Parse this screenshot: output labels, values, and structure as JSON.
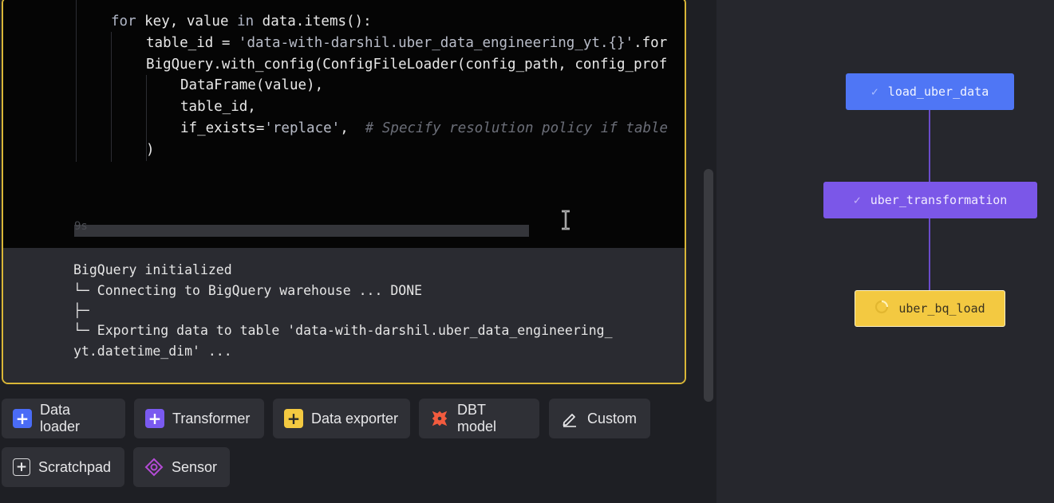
{
  "code": {
    "lines": {
      "l1": {
        "kw_for": "for",
        "rest1": " key, value ",
        "kw_in": "in",
        "rest2": " data.items():"
      },
      "l2": {
        "pre": "table_id = ",
        "str": "'data-with-darshil.uber_data_engineering_yt.{}'",
        "post": ".for"
      },
      "l3": {
        "text": "BigQuery.with_config(ConfigFileLoader(config_path, config_prof"
      },
      "l4": {
        "text": "DataFrame(value),"
      },
      "l5": {
        "text": "table_id,"
      },
      "l6": {
        "pre": "if_exists=",
        "str": "'replace'",
        "sep": ",  ",
        "comment": "# Specify resolution policy if table"
      },
      "l7": {
        "text": ")"
      }
    },
    "timer": "9s",
    "progress_fraction": 1.0
  },
  "output": {
    "lines": [
      "BigQuery initialized",
      "└─ Connecting to BigQuery warehouse ... DONE",
      "├─",
      "└─ Exporting data to table 'data-with-darshil.uber_data_engineering_",
      "yt.datetime_dim' ..."
    ]
  },
  "add_buttons": {
    "data_loader": {
      "label": "Data loader",
      "icon": "plus-icon",
      "color": "#4a6cf7"
    },
    "transformer": {
      "label": "Transformer",
      "icon": "plus-icon",
      "color": "#7a5af0"
    },
    "data_exporter": {
      "label": "Data exporter",
      "icon": "plus-icon",
      "color": "#f3c941"
    },
    "dbt_model": {
      "label": "DBT model",
      "icon": "dbt-logo-icon",
      "color": "#f25b3e"
    },
    "custom": {
      "label": "Custom",
      "icon": "pencil-icon"
    },
    "scratchpad": {
      "label": "Scratchpad",
      "icon": "plus-icon"
    },
    "sensor": {
      "label": "Sensor",
      "icon": "sensor-icon",
      "color": "#b44bd6"
    }
  },
  "pipeline": {
    "nodes": {
      "load": {
        "label": "load_uber_data",
        "status": "done",
        "status_icon": "check-icon",
        "color": "#4f76f5"
      },
      "transform": {
        "label": "uber_transformation",
        "status": "done",
        "status_icon": "check-icon",
        "color": "#7b57e8"
      },
      "export": {
        "label": "uber_bq_load",
        "status": "running",
        "status_icon": "spinner-icon",
        "color": "#f3c941"
      }
    },
    "edge_color": "#6a4bc9"
  }
}
